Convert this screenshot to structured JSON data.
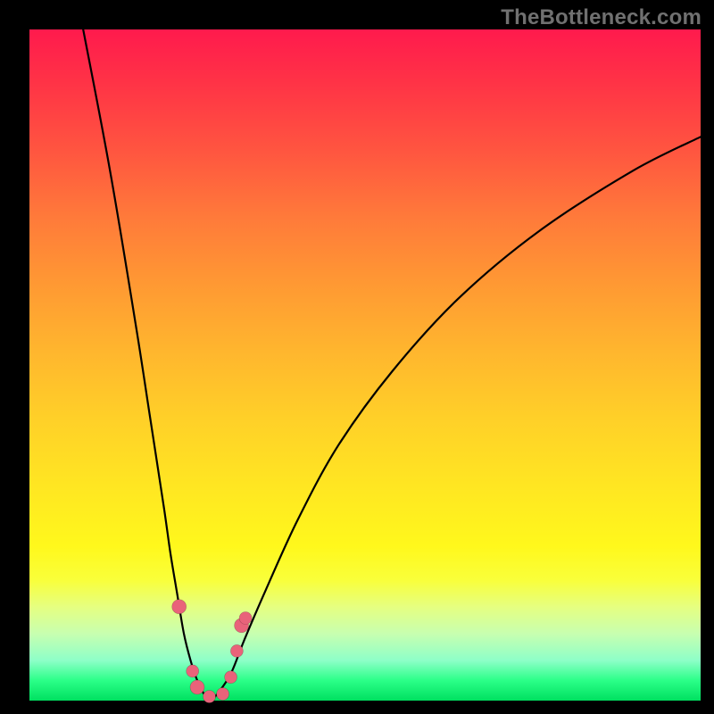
{
  "watermark": "TheBottleneck.com",
  "accent_dot_color": "#e9637a",
  "chart_data": {
    "type": "line",
    "title": "",
    "xlabel": "",
    "ylabel": "",
    "xlim": [
      0,
      100
    ],
    "ylim": [
      0,
      100
    ],
    "grid": false,
    "legend": null,
    "annotations": [],
    "series": [
      {
        "name": "left-branch",
        "x": [
          8,
          12,
          16,
          18,
          20,
          21,
          22,
          23,
          24,
          25,
          26,
          27
        ],
        "y": [
          100,
          79,
          55,
          42,
          29,
          22,
          16,
          10,
          6,
          3,
          1,
          0
        ]
      },
      {
        "name": "right-branch",
        "x": [
          27,
          28,
          30,
          32,
          35,
          40,
          46,
          54,
          64,
          76,
          90,
          100
        ],
        "y": [
          0,
          1,
          4,
          9,
          16,
          27,
          38,
          49,
          60,
          70,
          79,
          84
        ]
      }
    ],
    "markers": [
      {
        "x": 22.3,
        "y": 14,
        "r": 8
      },
      {
        "x": 24.3,
        "y": 4.4,
        "r": 7
      },
      {
        "x": 25.0,
        "y": 2.0,
        "r": 8
      },
      {
        "x": 26.8,
        "y": 0.6,
        "r": 7
      },
      {
        "x": 28.8,
        "y": 1.0,
        "r": 7
      },
      {
        "x": 30.0,
        "y": 3.5,
        "r": 7
      },
      {
        "x": 30.9,
        "y": 7.4,
        "r": 7
      },
      {
        "x": 31.6,
        "y": 11.2,
        "r": 8
      },
      {
        "x": 32.2,
        "y": 12.3,
        "r": 7
      }
    ],
    "vertex_x_pct": 27,
    "gradient_stops": [
      {
        "pct": 0,
        "color": "#ff1a4d"
      },
      {
        "pct": 50,
        "color": "#ffcc22"
      },
      {
        "pct": 80,
        "color": "#f8ff40"
      },
      {
        "pct": 100,
        "color": "#00e060"
      }
    ]
  }
}
